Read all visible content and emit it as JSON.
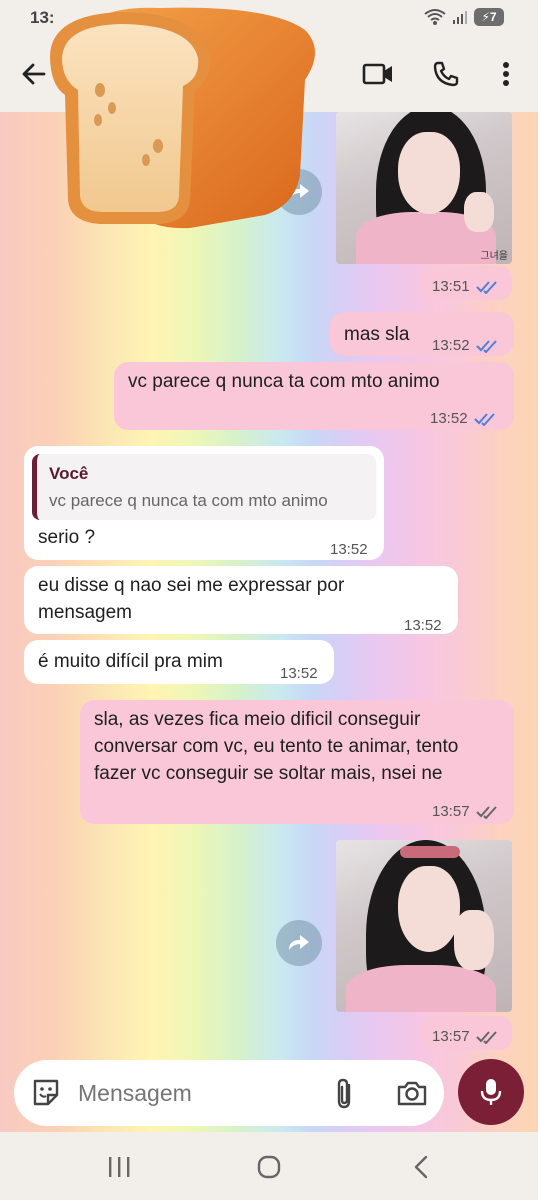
{
  "status_bar": {
    "time": "13:",
    "battery": "7"
  },
  "messages": {
    "m1_time": "13:51",
    "m2_text": "mas sla",
    "m2_time": "13:52",
    "m3_text": "vc parece q nunca ta com mto animo",
    "m3_time": "13:52",
    "m4_quote_author": "Você",
    "m4_quote_text": "vc parece q nunca ta com mto animo",
    "m4_text": "serio  ?",
    "m4_time": "13:52",
    "m5_text": "eu disse q nao sei me expressar por mensagem",
    "m5_time": "13:52",
    "m6_text": "é muito difícil pra mim",
    "m6_time": "13:52",
    "m7_text": "sla, as vezes fica meio dificil conseguir conversar com vc, eu tento te animar, tento fazer vc conseguir se soltar mais, nsei ne",
    "m7_time": "13:57",
    "m8_time": "13:57",
    "photo_caption": "그녀을"
  },
  "input": {
    "placeholder": "Mensagem"
  },
  "colors": {
    "outgoing": "#f9c7d8",
    "incoming": "#ffffff",
    "accent": "#7a1f35",
    "tick_read": "#4f7fd9",
    "tick_sent": "#666666"
  },
  "icons": [
    "back-arrow-icon",
    "video-call-icon",
    "phone-icon",
    "more-vert-icon",
    "bread-emoji",
    "forward-icon",
    "sticker-icon",
    "attach-icon",
    "camera-icon",
    "mic-icon",
    "recents-icon",
    "home-icon",
    "back-nav-icon",
    "wifi-icon",
    "signal-icon",
    "battery-icon"
  ]
}
